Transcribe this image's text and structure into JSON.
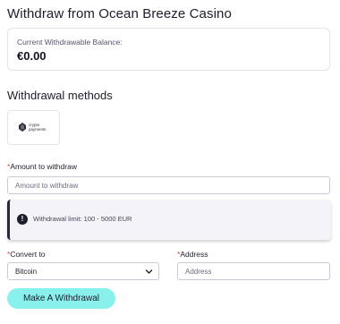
{
  "page": {
    "title": "Withdraw from Ocean Breeze Casino"
  },
  "balance": {
    "label": "Current Withdrawable Balance:",
    "value": "€0.00"
  },
  "methods": {
    "section_title": "Withdrawal methods",
    "items": [
      {
        "logo_line1": "crypto",
        "logo_line2": "payments",
        "icon": "crypto-payments-logo"
      }
    ]
  },
  "amount": {
    "required_mark": "*",
    "label": "Amount to withdraw",
    "placeholder": "Amount to withdraw"
  },
  "limit": {
    "icon": "!",
    "text": "Withdrawal limit: 100 - 5000 EUR"
  },
  "convert": {
    "required_mark": "*",
    "label": "Convert to",
    "selected": "Bitcoin"
  },
  "address": {
    "required_mark": "*",
    "label": "Address",
    "placeholder": "Address"
  },
  "submit": {
    "label": "Make A Withdrawal"
  },
  "colors": {
    "accent": "#8af0ec",
    "required": "#e0463a",
    "text": "#1d1d2b"
  }
}
